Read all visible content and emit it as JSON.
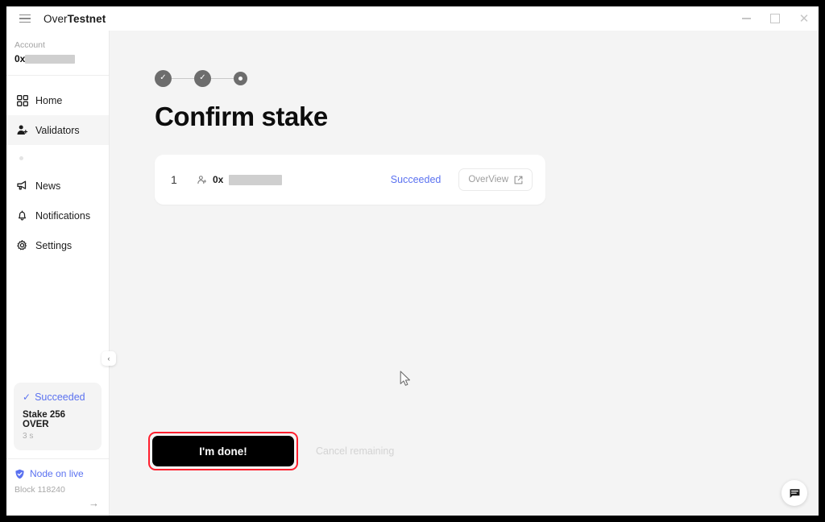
{
  "window": {
    "title_regular": "Over",
    "title_bold": "Testnet",
    "menu_icon": "hamburger-icon",
    "controls": {
      "minimize": "–",
      "maximize": "□",
      "close": "✕"
    }
  },
  "sidebar": {
    "account": {
      "label": "Account",
      "address_prefix": "0x",
      "address_redacted": true
    },
    "items": [
      {
        "label": "Home",
        "icon": "grid-icon",
        "active": false
      },
      {
        "label": "Validators",
        "icon": "person-icon",
        "active": true
      },
      {
        "label": "",
        "icon": "dot-icon",
        "active": false
      },
      {
        "label": "News",
        "icon": "megaphone-icon",
        "active": false
      },
      {
        "label": "Notifications",
        "icon": "bell-icon",
        "active": false
      },
      {
        "label": "Settings",
        "icon": "gear-icon",
        "active": false
      }
    ],
    "toast": {
      "status": "Succeeded",
      "status_icon": "check-icon",
      "description": "Stake 256 OVER",
      "elapsed": "3 s"
    },
    "node": {
      "status": "Node on live",
      "status_icon": "shield-check-icon",
      "block": "Block 118240",
      "arrow": "→"
    },
    "collapse_toggle": "‹"
  },
  "main": {
    "stepper": [
      {
        "state": "done",
        "glyph": "✓"
      },
      {
        "state": "done",
        "glyph": "✓"
      },
      {
        "state": "current",
        "glyph": ""
      }
    ],
    "title": "Confirm stake",
    "validator_row": {
      "index": "1",
      "icon": "person-icon",
      "address_prefix": "0x",
      "address_redacted": true,
      "status": "Succeeded",
      "overview_label": "OverView",
      "overview_icon": "external-link-icon"
    },
    "actions": {
      "done_label": "I'm done!",
      "cancel_label": "Cancel remaining",
      "highlight_color": "#ff1f2e"
    },
    "chat_fab_icon": "chat-icon"
  },
  "colors": {
    "accent_blue": "#5b72f0",
    "step_gray": "#6d6d6d",
    "background": "#f4f4f4",
    "panel": "#ffffff"
  }
}
